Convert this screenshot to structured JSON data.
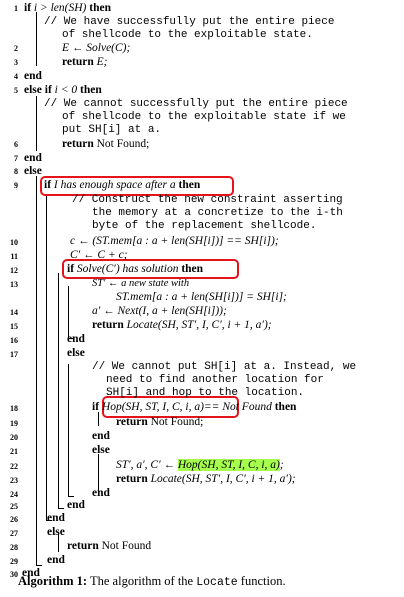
{
  "lines": {
    "l1": {
      "num": "1",
      "kw1": "if",
      "cond": "i > len(SH)",
      "kw2": "then"
    },
    "c1a": "// We have successfully put the entire piece",
    "c1b": "of shellcode to the exploitable state.",
    "l2": {
      "num": "2",
      "text": "E ← Solve(C);"
    },
    "l3": {
      "num": "3",
      "kw": "return",
      "text": "E;"
    },
    "l4": {
      "num": "4",
      "kw": "end"
    },
    "l5": {
      "num": "5",
      "kw1": "else if",
      "cond": "i < 0",
      "kw2": "then"
    },
    "c5a": "// We cannot successfully put the entire piece",
    "c5b": "of shellcode to the exploitable state if we",
    "c5c": "put SH[i] at a.",
    "l6": {
      "num": "6",
      "kw": "return",
      "text": "Not Found;"
    },
    "l7": {
      "num": "7",
      "kw": "end"
    },
    "l8": {
      "num": "8",
      "kw": "else"
    },
    "l9": {
      "num": "9",
      "kw1": "if",
      "cond": "I has enough space after a",
      "kw2": "then"
    },
    "c9a": "// Construct the new constraint asserting",
    "c9b": "the memory at a concretize to the i-th",
    "c9c": "byte of the replacement shellcode.",
    "l10": {
      "num": "10",
      "text": "c ← (ST.mem[a : a + len(SH[i])] == SH[i]);"
    },
    "l11": {
      "num": "11",
      "text": "C′ ← C + c;"
    },
    "l12": {
      "num": "12",
      "kw1": "if",
      "cond": "Solve(C′) has solution",
      "kw2": "then"
    },
    "l13": {
      "num": "13",
      "text1": "ST′ ← a new state with",
      "text2": "ST.mem[a : a + len(SH[i])] = SH[i];"
    },
    "l14": {
      "num": "14",
      "text": "a′ ← Next(I, a + len(SH[i]));"
    },
    "l15": {
      "num": "15",
      "kw": "return",
      "text": "Locate(SH, ST′, I, C′, i + 1, a′);"
    },
    "l16": {
      "num": "16",
      "kw": "end"
    },
    "l17": {
      "num": "17",
      "kw": "else"
    },
    "c17a": "// We cannot put SH[i] at a. Instead, we",
    "c17b": "need to find another location for",
    "c17c": "SH[i] and hop to the location.",
    "l18": {
      "num": "18",
      "kw1": "if",
      "cond": "Hop(SH, ST, I, C, i, a)",
      "mid": "== Not Found",
      "kw2": "then"
    },
    "l19": {
      "num": "19",
      "kw": "return",
      "text": "Not Found;"
    },
    "l20": {
      "num": "20",
      "kw": "end"
    },
    "l21": {
      "num": "21",
      "kw": "else"
    },
    "l22": {
      "num": "22",
      "text": "ST′, a′, C′ ←",
      "hl": "Hop(SH, ST, I, C, i, a)",
      "tail": ";"
    },
    "l23": {
      "num": "23",
      "kw": "return",
      "text": "Locate(SH, ST′, I, C′, i + 1, a′);"
    },
    "l24": {
      "num": "24",
      "kw": "end"
    },
    "l25": {
      "num": "25",
      "kw": "end"
    },
    "l26": {
      "num": "26",
      "kw": "end"
    },
    "l27": {
      "num": "27",
      "kw": "else"
    },
    "l28": {
      "num": "28",
      "kw": "return",
      "text": "Not Found"
    },
    "l29": {
      "num": "29",
      "kw": "end"
    },
    "l30": {
      "num": "30",
      "kw": "end"
    }
  },
  "caption": {
    "prefix": "Algorithm 1:",
    "text": "The algorithm of the",
    "func": "Locate",
    "suffix": "function."
  },
  "colors": {
    "highlight_box": "#e5141b",
    "highlight_fill": "#a6ff4d"
  }
}
